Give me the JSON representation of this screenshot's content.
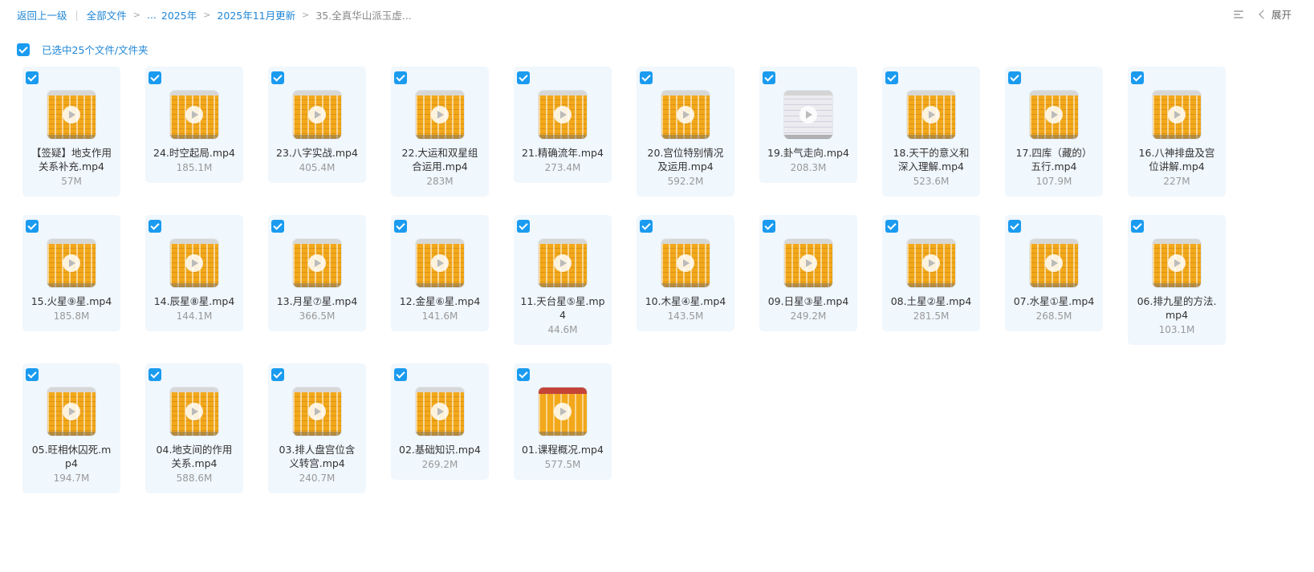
{
  "breadcrumb": {
    "back": "返回上一级",
    "all_files": "全部文件",
    "ellipsis": "...",
    "level1": "2025年",
    "level2": "2025年11月更新",
    "current": "35.全真华山派玉虚..."
  },
  "toolbar": {
    "expand_label": "展开"
  },
  "selection": {
    "text": "已选中25个文件/文件夹"
  },
  "colors": {
    "accent": "#1a9bf0",
    "link": "#1f86d6",
    "card_bg": "#f0f7fd"
  },
  "files": [
    {
      "name": "【签疑】地支作用关系补充.mp4",
      "size": "57M",
      "thumb": "orange"
    },
    {
      "name": "24.时空起局.mp4",
      "size": "185.1M",
      "thumb": "orange"
    },
    {
      "name": "23.八字实战.mp4",
      "size": "405.4M",
      "thumb": "orange"
    },
    {
      "name": "22.大运和双星组合运用.mp4",
      "size": "283M",
      "thumb": "orange"
    },
    {
      "name": "21.精确流年.mp4",
      "size": "273.4M",
      "thumb": "orange"
    },
    {
      "name": "20.宫位特别情况及运用.mp4",
      "size": "592.2M",
      "thumb": "orange"
    },
    {
      "name": "19.卦气走向.mp4",
      "size": "208.3M",
      "thumb": "gray"
    },
    {
      "name": "18.天干的意义和深入理解.mp4",
      "size": "523.6M",
      "thumb": "orange"
    },
    {
      "name": "17.四库（藏的）五行.mp4",
      "size": "107.9M",
      "thumb": "orange"
    },
    {
      "name": "16.八神排盘及宫位讲解.mp4",
      "size": "227M",
      "thumb": "orange"
    },
    {
      "name": "15.火星⑨星.mp4",
      "size": "185.8M",
      "thumb": "orange"
    },
    {
      "name": "14.辰星⑧星.mp4",
      "size": "144.1M",
      "thumb": "orange"
    },
    {
      "name": "13.月星⑦星.mp4",
      "size": "366.5M",
      "thumb": "orange"
    },
    {
      "name": "12.金星⑥星.mp4",
      "size": "141.6M",
      "thumb": "orange"
    },
    {
      "name": "11.天台星⑤星.mp4",
      "size": "44.6M",
      "thumb": "orange"
    },
    {
      "name": "10.木星④星.mp4",
      "size": "143.5M",
      "thumb": "orange"
    },
    {
      "name": "09.日星③星.mp4",
      "size": "249.2M",
      "thumb": "orange"
    },
    {
      "name": "08.土星②星.mp4",
      "size": "281.5M",
      "thumb": "orange"
    },
    {
      "name": "07.水星①星.mp4",
      "size": "268.5M",
      "thumb": "orange"
    },
    {
      "name": "06.排九星的方法.mp4",
      "size": "103.1M",
      "thumb": "orange"
    },
    {
      "name": "05.旺相休囚死.mp4",
      "size": "194.7M",
      "thumb": "orange"
    },
    {
      "name": "04.地支间的作用关系.mp4",
      "size": "588.6M",
      "thumb": "orange"
    },
    {
      "name": "03.排人盘宫位含义转宫.mp4",
      "size": "240.7M",
      "thumb": "orange"
    },
    {
      "name": "02.基础知识.mp4",
      "size": "269.2M",
      "thumb": "orange"
    },
    {
      "name": "01.课程概况.mp4",
      "size": "577.5M",
      "thumb": "red"
    }
  ]
}
